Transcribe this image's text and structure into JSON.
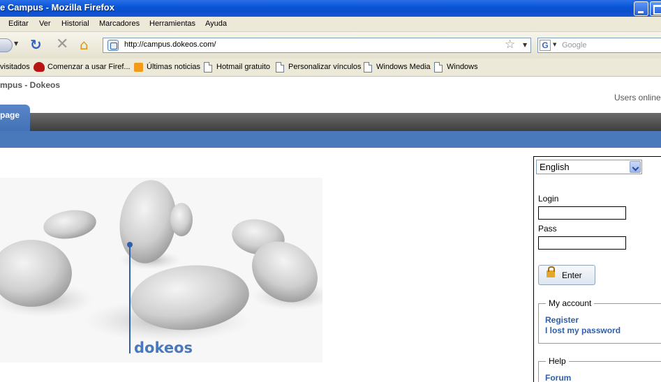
{
  "window": {
    "title": "e Campus - Mozilla Firefox"
  },
  "menu": {
    "items": [
      "Editar",
      "Ver",
      "Historial",
      "Marcadores",
      "Herramientas",
      "Ayuda"
    ]
  },
  "navbar": {
    "url": "http://campus.dokeos.com/",
    "search_placeholder": "Google"
  },
  "bookmarks": {
    "items": [
      "visitados",
      "Comenzar a usar Firef...",
      "Últimas noticias",
      "Hotmail gratuito",
      "Personalizar vínculos",
      "Windows Media",
      "Windows"
    ]
  },
  "page": {
    "site_name": "mpus - Dokeos",
    "users_online": "Users online",
    "tab_home": "page",
    "logo_text": "dokeos"
  },
  "sidebar": {
    "language": "English",
    "login_label": "Login",
    "pass_label": "Pass",
    "enter_label": "Enter",
    "my_account": {
      "legend": "My account",
      "links": [
        "Register",
        "I lost my password"
      ]
    },
    "help": {
      "legend": "Help",
      "links": [
        "Forum"
      ]
    }
  },
  "colors": {
    "titlebar": "#0a56d8",
    "tab_blue": "#4a79bb",
    "link_blue": "#2f5fa8"
  }
}
